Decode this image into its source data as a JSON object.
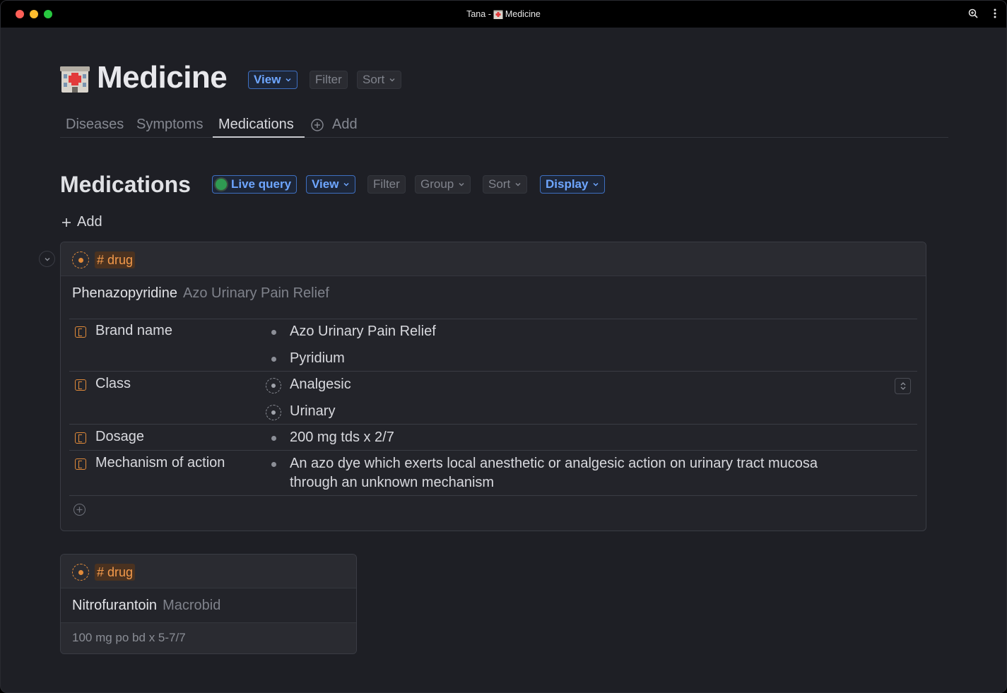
{
  "window": {
    "title": "Tana - ",
    "title_page": "Medicine"
  },
  "page": {
    "title": "Medicine",
    "view_label": "View",
    "filter_label": "Filter",
    "sort_label": "Sort"
  },
  "tabs": [
    {
      "label": "Diseases"
    },
    {
      "label": "Symptoms"
    },
    {
      "label": "Medications",
      "active": true
    },
    {
      "label": "Add"
    }
  ],
  "section": {
    "title": "Medications",
    "live_query_label": "Live query",
    "view_label": "View",
    "filter_label": "Filter",
    "group_label": "Group",
    "sort_label": "Sort",
    "display_label": "Display",
    "add_label": "Add"
  },
  "cards": [
    {
      "tag": "# drug",
      "name": "Phenazopyridine",
      "subtitle": "Azo Urinary Pain Relief",
      "fields": [
        {
          "name": "Brand name",
          "values": [
            "Azo Urinary Pain Relief",
            "Pyridium"
          ]
        },
        {
          "name": "Class",
          "values": [
            "Analgesic",
            "Urinary"
          ]
        },
        {
          "name": "Dosage",
          "values": [
            "200 mg tds x 2/7"
          ]
        },
        {
          "name": "Mechanism of action",
          "values": [
            "An azo dye which exerts local anesthetic or analgesic action on urinary tract mucosa",
            "through an unknown mechanism"
          ]
        }
      ]
    },
    {
      "tag": "# drug",
      "name": "Nitrofurantoin",
      "subtitle": "Macrobid",
      "footer": "100 mg po bd x 5-7/7"
    }
  ],
  "colors": {
    "accent_blue": "#6ea6ff",
    "tag_orange": "#f39a4b",
    "background": "#1e1f25"
  }
}
